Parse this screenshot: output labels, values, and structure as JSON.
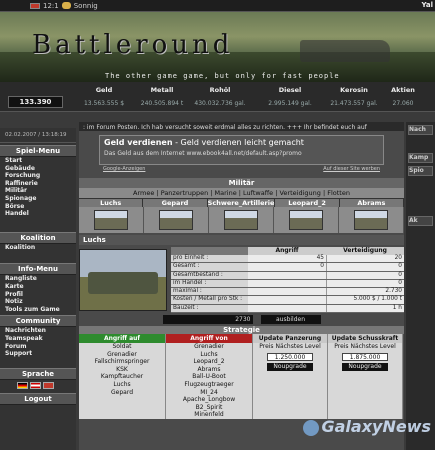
{
  "topbar": {
    "time": "12:1",
    "weather": "Sonnig",
    "user": "Yal"
  },
  "banner": {
    "logo": "Battleround",
    "tagline": "The other game game, but only for fast people"
  },
  "resources": {
    "money": "133.390",
    "items": [
      {
        "name": "Geld",
        "value": "13.563.555 $"
      },
      {
        "name": "Metall",
        "value": "240.505.894 t"
      },
      {
        "name": "Rohöl",
        "value": "430.032.736 gal."
      },
      {
        "name": "Diesel",
        "value": "2.995.149 gal."
      },
      {
        "name": "Kerosin",
        "value": "21.473.557 gal."
      },
      {
        "name": "Aktien",
        "value": "27.060"
      }
    ]
  },
  "left": {
    "date": "02.02.2007 / 13:18:19",
    "spielmenu": {
      "title": "Spiel-Menu",
      "items": [
        "Start",
        "Gebäude",
        "Forschung",
        "Raffinerie",
        "Militär",
        "Spionage",
        "Börse",
        "Handel"
      ]
    },
    "koalition": {
      "title": "Koalition",
      "items": [
        "Koalition"
      ]
    },
    "info": {
      "title": "Info-Menu",
      "items": [
        "Rangliste",
        "Karte",
        "Profil",
        "Notiz",
        "Tools zum Game"
      ]
    },
    "community": {
      "title": "Community",
      "items": [
        "Nachrichten",
        "Teamspeak",
        "Forum",
        "Support"
      ]
    },
    "sprache": {
      "title": "Sprache"
    },
    "logout": "Logout"
  },
  "main": {
    "ticker": ": im Forum Posten. Ich hab versucht soweit erdmal alles zu richten. +++ Ihr befindet euch auf",
    "ad": {
      "title": "Geld verdienen",
      "title_rest": " - Geld verdienen leicht gemacht",
      "sub": "Das Geld aus dem Internet www.ebook4all.net/default.asp?promo",
      "link_left": "Google-Anzeigen",
      "link_right": "Auf dieser Site werben"
    },
    "military_title": "Militär",
    "subnav": "Armee | Panzertruppen | Marine | Luftwaffe | Verteidigung | Flotten",
    "units": [
      "Luchs",
      "Gepard",
      "Schwere_Artillerie",
      "Leopard_2",
      "Abrams"
    ],
    "selected_unit": "Luchs",
    "stats_headers": {
      "attack": "Angriff",
      "defense": "Verteidigung"
    },
    "stats": [
      {
        "label": "pro Einheit :",
        "a": "45",
        "b": "20"
      },
      {
        "label": "Gesamt :",
        "a": "0",
        "b": "0"
      },
      {
        "label": "Gesamtbestand :",
        "a": "",
        "b": "0"
      },
      {
        "label": "im Handel :",
        "a": "",
        "b": "0"
      },
      {
        "label": "maximal :",
        "a": "",
        "b": "2.730"
      },
      {
        "label": "Kosten / Metall pro Stk :",
        "a": "",
        "b": "5.000 $ / 1.000 t"
      },
      {
        "label": "Bauzeit :",
        "a": "",
        "b": "1 h"
      }
    ],
    "build_count": "2730",
    "build_button": "ausbilden",
    "strategy_title": "Strategie",
    "strategy": {
      "attack_on": {
        "title": "Angriff auf",
        "items": [
          "Soldat",
          "Grenadier",
          "Fallschirmspringer",
          "KSK",
          "Kampftaucher",
          "Luchs",
          "Gepard"
        ]
      },
      "attack_from": {
        "title": "Angriff von",
        "items": [
          "Grenadier",
          "Luchs",
          "Leopard_2",
          "Abrams",
          "Ball-U-Boot",
          "Flugzeugtraeger",
          "MI_24",
          "Apache_Longbow",
          "B2_Spirit",
          "Minenfeld"
        ]
      },
      "armor": {
        "title": "Update Panzerung",
        "label": "Preis Nächstes Level",
        "price": "1.250.000",
        "button": "Noupgrade"
      },
      "firepower": {
        "title": "Update Schusskraft",
        "label": "Preis Nächstes Level",
        "price": "1.875.000",
        "button": "Noupgrade"
      }
    }
  },
  "right": {
    "labels": [
      "Nach",
      "Kamp",
      "Spio",
      "Ak"
    ]
  },
  "watermark": "GalaxyNews"
}
